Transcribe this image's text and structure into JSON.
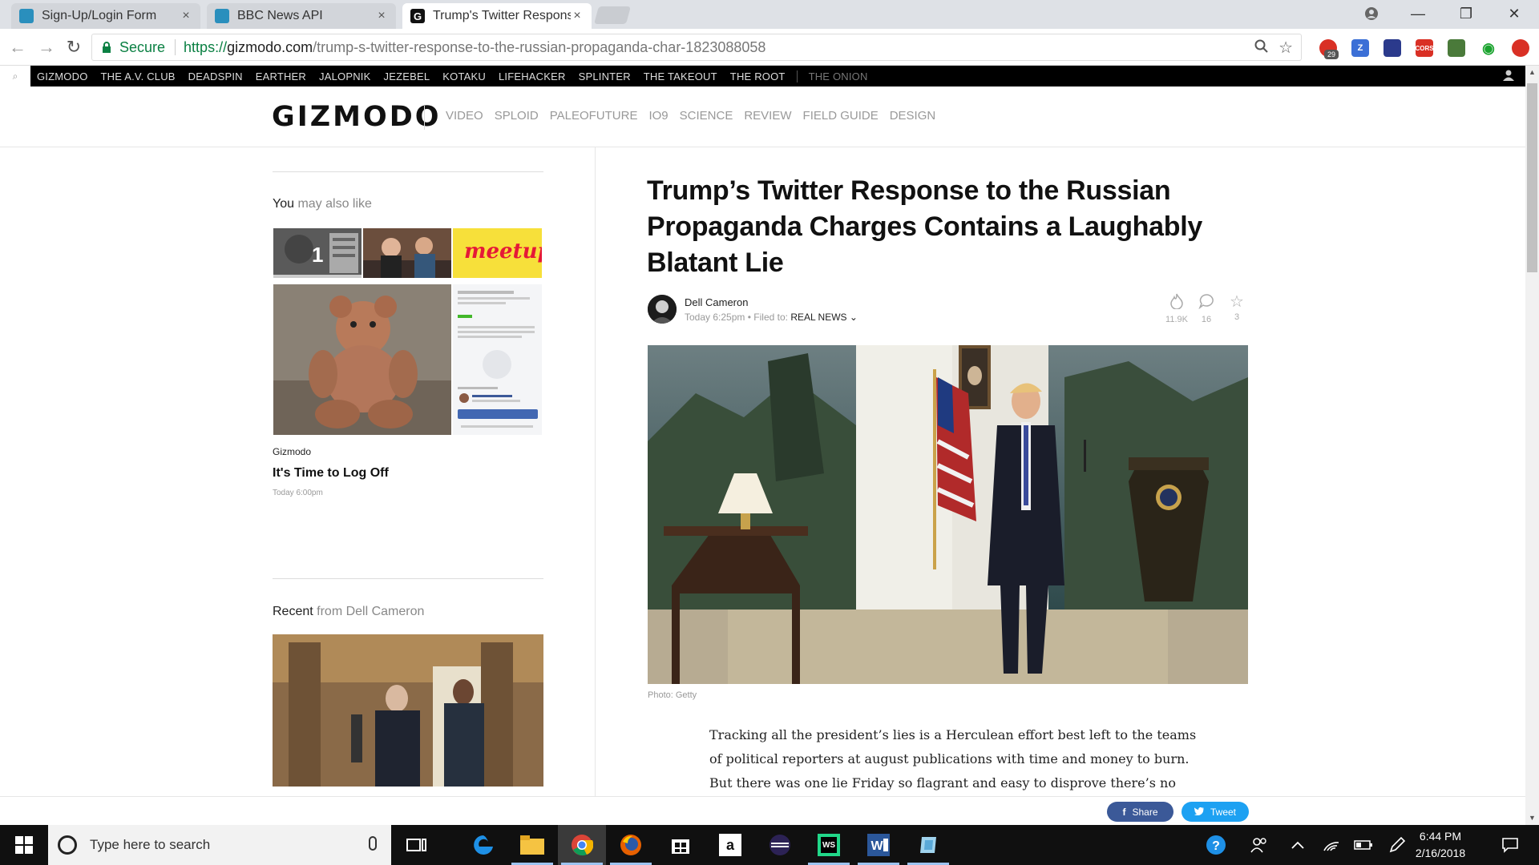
{
  "browser": {
    "tabs": [
      {
        "title": "Sign-Up/Login Form",
        "close": "×",
        "favicon_color": "#2a8fbd"
      },
      {
        "title": "BBC News API",
        "close": "×",
        "favicon_color": "#2a8fbd"
      },
      {
        "title": "Trump's Twitter Respons",
        "close": "×",
        "favicon_color": "#111111"
      }
    ],
    "window": {
      "minimize": "—",
      "restore": "❐",
      "close": "✕"
    },
    "toolbar": {
      "back": "←",
      "forward": "→",
      "reload": "↻"
    },
    "address": {
      "secure_label": "Secure",
      "scheme": "https://",
      "domain": "gizmodo.com",
      "path": "/trump-s-twitter-response-to-the-russian-propaganda-char-1823088058"
    },
    "extensions": {
      "badge_count": "29",
      "z_label": "Z",
      "cors_label": "CORS"
    }
  },
  "network_bar": {
    "items": [
      "GIZMODO",
      "THE A.V. CLUB",
      "DEADSPIN",
      "EARTHER",
      "JALOPNIK",
      "JEZEBEL",
      "KOTAKU",
      "LIFEHACKER",
      "SPLINTER",
      "THE TAKEOUT",
      "THE ROOT"
    ],
    "onion": "THE ONION"
  },
  "site": {
    "logo": "GIZMODO",
    "nav": [
      "VIDEO",
      "SPLOID",
      "PALEOFUTURE",
      "IO9",
      "SCIENCE",
      "REVIEW",
      "FIELD GUIDE",
      "DESIGN"
    ]
  },
  "sidebar": {
    "also_like": {
      "title_strong": "You",
      "title_muted": " may also like"
    },
    "featured": {
      "source": "Gizmodo",
      "title": "It's Time to Log Off",
      "time": "Today 6:00pm",
      "rank": "1",
      "meetup_text": "meetup"
    },
    "recent": {
      "title_strong": "Recent",
      "title_muted": " from Dell Cameron"
    }
  },
  "article": {
    "headline": "Trump’s Twitter Response to the Russian Propaganda Charges Contains a Laughably Blatant Lie",
    "author": "Dell Cameron",
    "time": "Today 6:25pm",
    "filed_label": "Filed to:",
    "filed_value": "REAL NEWS",
    "stats": {
      "views": "11.9K",
      "comments": "16",
      "stars": "3"
    },
    "photo_credit": "Photo: Getty",
    "body_lines": [
      "Tracking all the president’s lies is a Herculean effort best left to the teams",
      "of political reporters at august publications with time and money to burn.",
      "But there was one lie Friday so flagrant and easy to disprove there’s no"
    ]
  },
  "share": {
    "facebook": "Share",
    "twitter": "Tweet",
    "facebook_color": "#3b5998",
    "twitter_color": "#1da1f2"
  },
  "taskbar": {
    "search_placeholder": "Type here to search",
    "time": "6:44 PM",
    "date": "2/16/2018"
  }
}
